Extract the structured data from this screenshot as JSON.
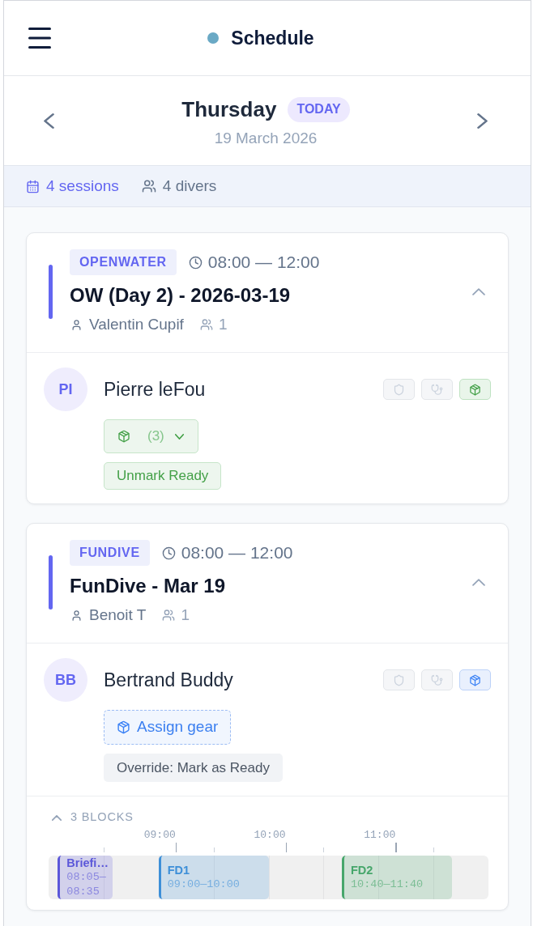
{
  "header": {
    "title": "Schedule"
  },
  "date_nav": {
    "day": "Thursday",
    "badge": "TODAY",
    "date": "19 March 2026"
  },
  "summary": {
    "sessions": "4 sessions",
    "divers": "4 divers"
  },
  "sessions": [
    {
      "type": "OPENWATER",
      "time": "08:00 — 12:00",
      "title": "OW (Day 2) - 2026-03-19",
      "instructor": "Valentin Cupif",
      "divers": "1",
      "expanded": true,
      "participants": [
        {
          "initials": "PI",
          "name": "Pierre leFou",
          "checks": [
            {
              "kind": "waiver",
              "complete": false,
              "attention": false
            },
            {
              "kind": "medical",
              "complete": false,
              "attention": false
            },
            {
              "kind": "gear",
              "complete": true,
              "attention": false
            }
          ],
          "gear": {
            "kind": "dropdown",
            "count": "(3)"
          },
          "ready": true,
          "ready_action": "Unmark Ready"
        }
      ]
    },
    {
      "type": "FUNDIVE",
      "time": "08:00 — 12:00",
      "title": "FunDive - Mar 19",
      "instructor": "Benoit T",
      "divers": "1",
      "expanded": true,
      "participants": [
        {
          "initials": "BB",
          "name": "Bertrand Buddy",
          "checks": [
            {
              "kind": "waiver",
              "complete": false,
              "attention": false
            },
            {
              "kind": "medical",
              "complete": false,
              "attention": false
            },
            {
              "kind": "gear",
              "complete": false,
              "attention": true
            }
          ],
          "gear": {
            "kind": "assign",
            "label": "Assign gear"
          },
          "ready": false,
          "ready_action": "Override: Mark as Ready"
        }
      ],
      "blocks": {
        "label": "3 BLOCKS",
        "expanded": true,
        "axis": [
          "09:00",
          "10:00",
          "11:00"
        ],
        "items": [
          {
            "title": "Briefi…",
            "time": "08:05—08:35",
            "color": "#5b57d9"
          },
          {
            "title": "FD1",
            "time": "09:00—10:00",
            "color": "#3d8fd8"
          },
          {
            "title": "FD2",
            "time": "10:40—11:40",
            "color": "#46a66b"
          }
        ]
      }
    }
  ]
}
